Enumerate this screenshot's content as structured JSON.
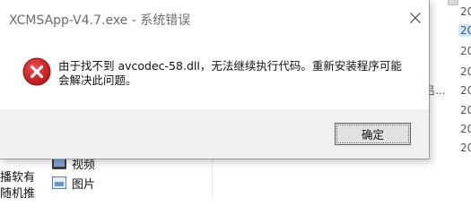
{
  "dialog": {
    "title": "XCMSApp-V4.7.exe - 系统错误",
    "close_icon": "close-icon",
    "error_icon": "error-x-icon",
    "message": "由于找不到 avcodec-58.dll，无法继续执行代码。重新安装程序可能会解决此问题。",
    "ok_label": "确定",
    "accent_color": "#0078d7",
    "error_color": "#e81123"
  },
  "background": {
    "sidebar_text_1": "播软有",
    "sidebar_text_2": "随机推",
    "nav_items": [
      {
        "label": "视频",
        "icon": "video-folder-icon"
      },
      {
        "label": "图片",
        "icon": "pictures-folder-icon"
      }
    ],
    "ellipsis": "吕...",
    "date_cells": [
      "20",
      "20",
      "20",
      "20",
      "20",
      "20",
      "20",
      "20"
    ]
  }
}
